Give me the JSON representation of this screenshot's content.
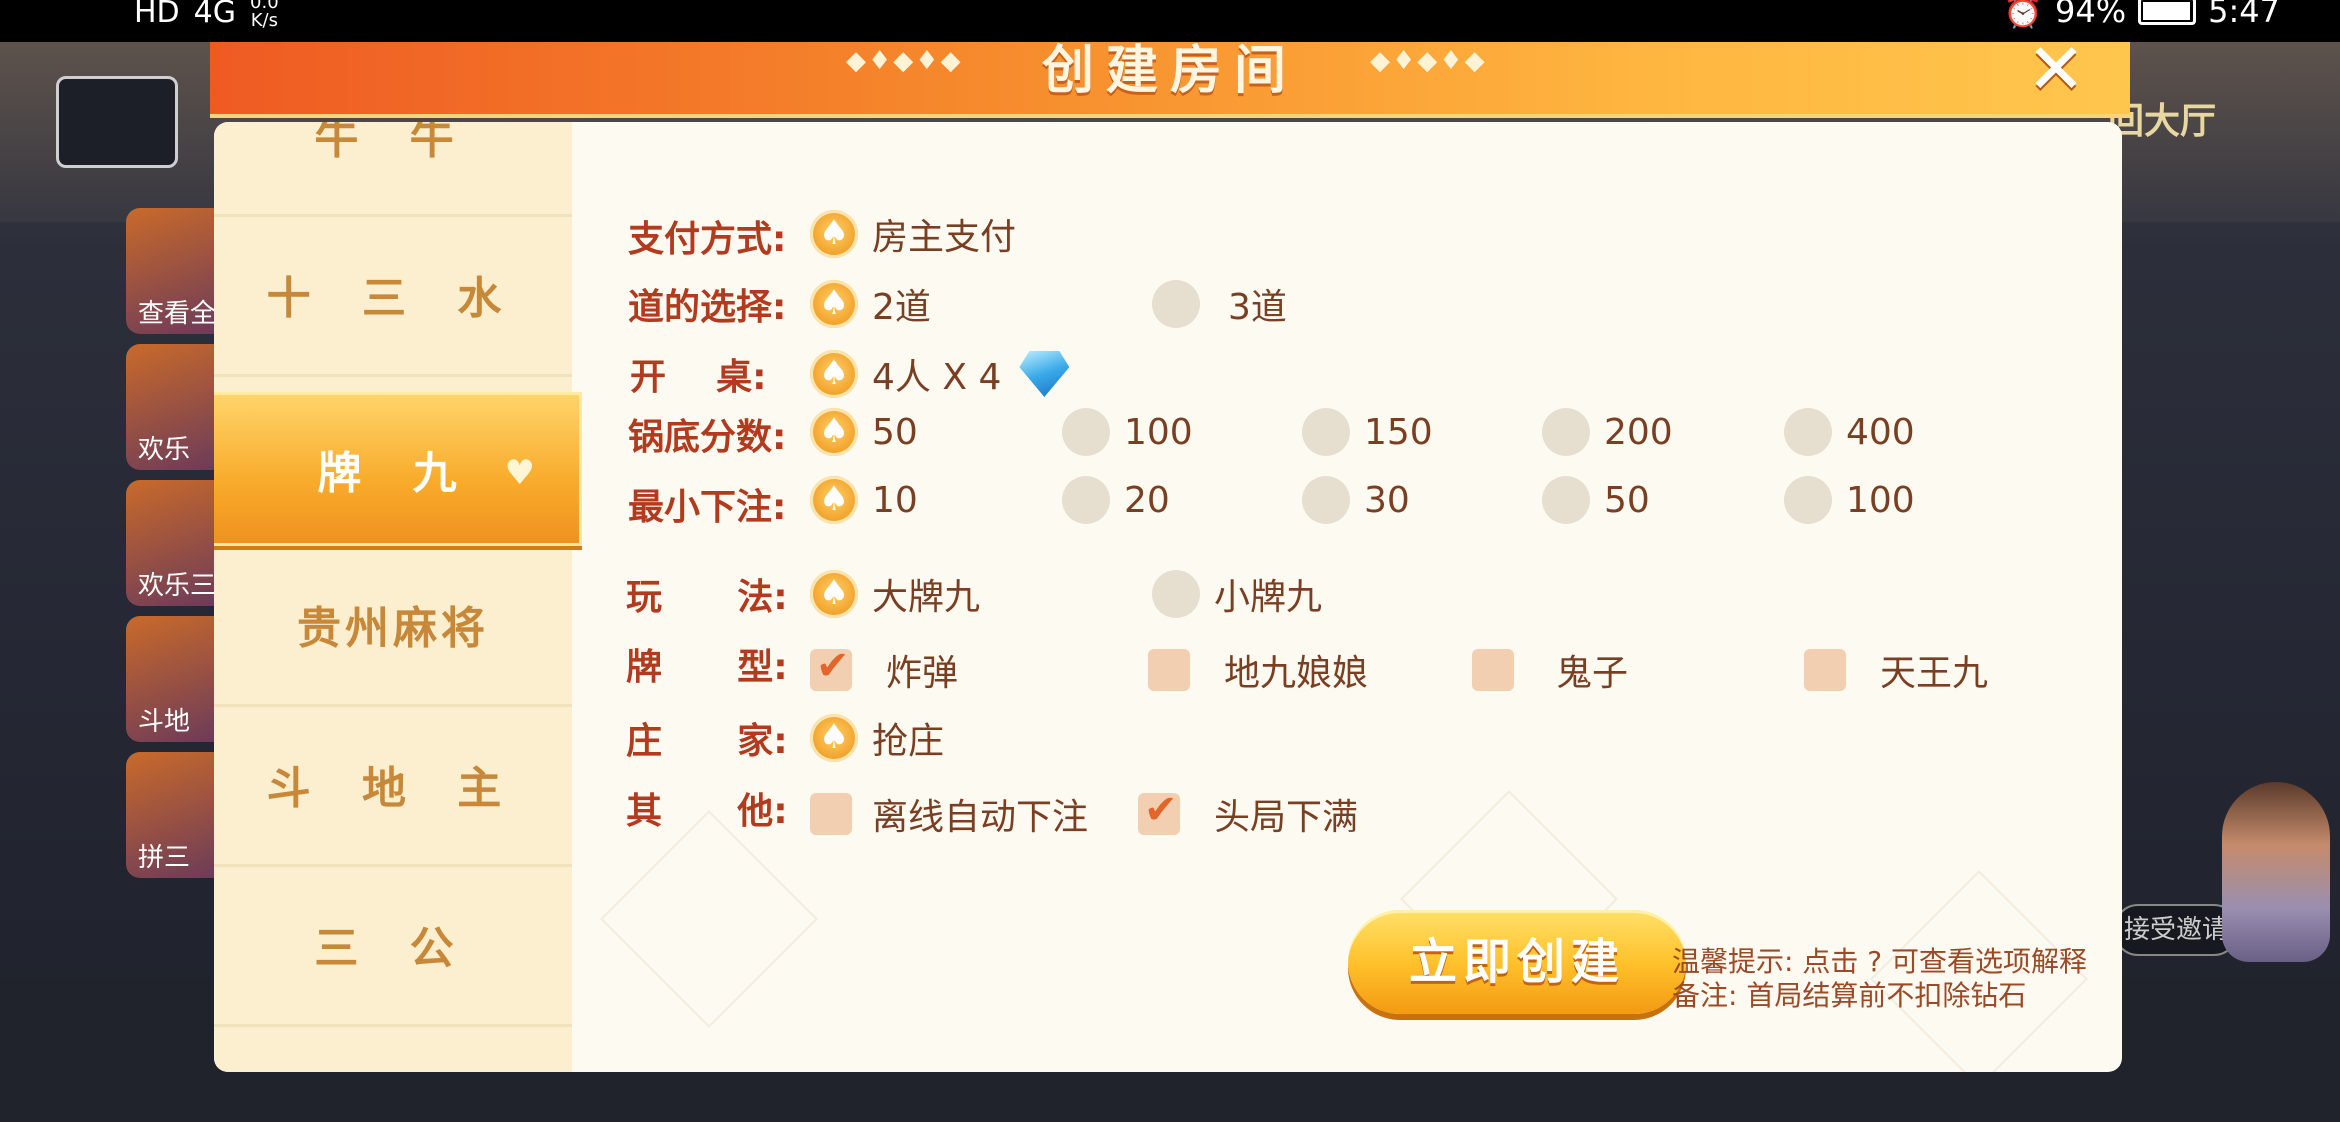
{
  "status_bar": {
    "left_indicators": "HD",
    "signal_text": "4G",
    "net_speed_value": "0.0",
    "net_speed_unit": "K/s",
    "battery_percent": "94%",
    "time": "5:47"
  },
  "background": {
    "lobby_label": "回大厅",
    "invite_label": "接受邀请",
    "tiles": [
      "查看全",
      "欢乐",
      "欢乐三",
      "斗地",
      "拼三"
    ]
  },
  "dialog": {
    "title": "创建房间",
    "close_icon": "close-icon"
  },
  "sidebar": {
    "items": [
      {
        "label": "牛  牛",
        "active": false
      },
      {
        "label": "十 三 水",
        "active": false
      },
      {
        "label": "牌   九",
        "active": true
      },
      {
        "label": "贵州麻将",
        "active": false
      },
      {
        "label": "斗 地 主",
        "active": false
      },
      {
        "label": "三  公",
        "active": false
      }
    ]
  },
  "form": {
    "payment": {
      "label": "支付方式:",
      "options": [
        {
          "text": "房主支付",
          "selected": true
        }
      ]
    },
    "dao": {
      "label": "道的选择:",
      "options": [
        {
          "text": "2道",
          "selected": true
        },
        {
          "text": "3道",
          "selected": false
        }
      ]
    },
    "table": {
      "label": "开    桌:",
      "options": [
        {
          "text": "4人 X 4",
          "selected": true,
          "icon": "diamond-icon"
        }
      ]
    },
    "base_score": {
      "label": "锅底分数:",
      "options": [
        {
          "text": "50",
          "selected": true
        },
        {
          "text": "100",
          "selected": false
        },
        {
          "text": "150",
          "selected": false
        },
        {
          "text": "200",
          "selected": false
        },
        {
          "text": "400",
          "selected": false
        }
      ]
    },
    "min_bet": {
      "label": "最小下注:",
      "options": [
        {
          "text": "10",
          "selected": true
        },
        {
          "text": "20",
          "selected": false
        },
        {
          "text": "30",
          "selected": false
        },
        {
          "text": "50",
          "selected": false
        },
        {
          "text": "100",
          "selected": false
        }
      ]
    },
    "play_mode": {
      "label": "玩      法:",
      "options": [
        {
          "text": "大牌九",
          "selected": true
        },
        {
          "text": "小牌九",
          "selected": false
        }
      ]
    },
    "card_type": {
      "label": "牌      型:",
      "options": [
        {
          "text": "炸弹",
          "checked": true
        },
        {
          "text": "地九娘娘",
          "checked": false
        },
        {
          "text": "鬼子",
          "checked": false
        },
        {
          "text": "天王九",
          "checked": false
        }
      ]
    },
    "banker": {
      "label": "庄      家:",
      "options": [
        {
          "text": "抢庄",
          "selected": true
        }
      ]
    },
    "other": {
      "label": "其      他:",
      "options": [
        {
          "text": "离线自动下注",
          "checked": false
        },
        {
          "text": "头局下满",
          "checked": true
        }
      ]
    }
  },
  "create_button": "立即创建",
  "tips": {
    "line1_prefix": "温馨提示: 点击",
    "line1_q": "?",
    "line1_suffix": "可查看选项解释",
    "line2": "备注: 首局结算前不扣除钻石"
  },
  "colors": {
    "header_gradient_start": "#ef5a23",
    "header_gradient_end": "#ffc64d",
    "label_red": "#b23a1e",
    "option_brown": "#7a3f22",
    "sidebar_text": "#c8883a",
    "selected_orange": "#f2a22a"
  }
}
